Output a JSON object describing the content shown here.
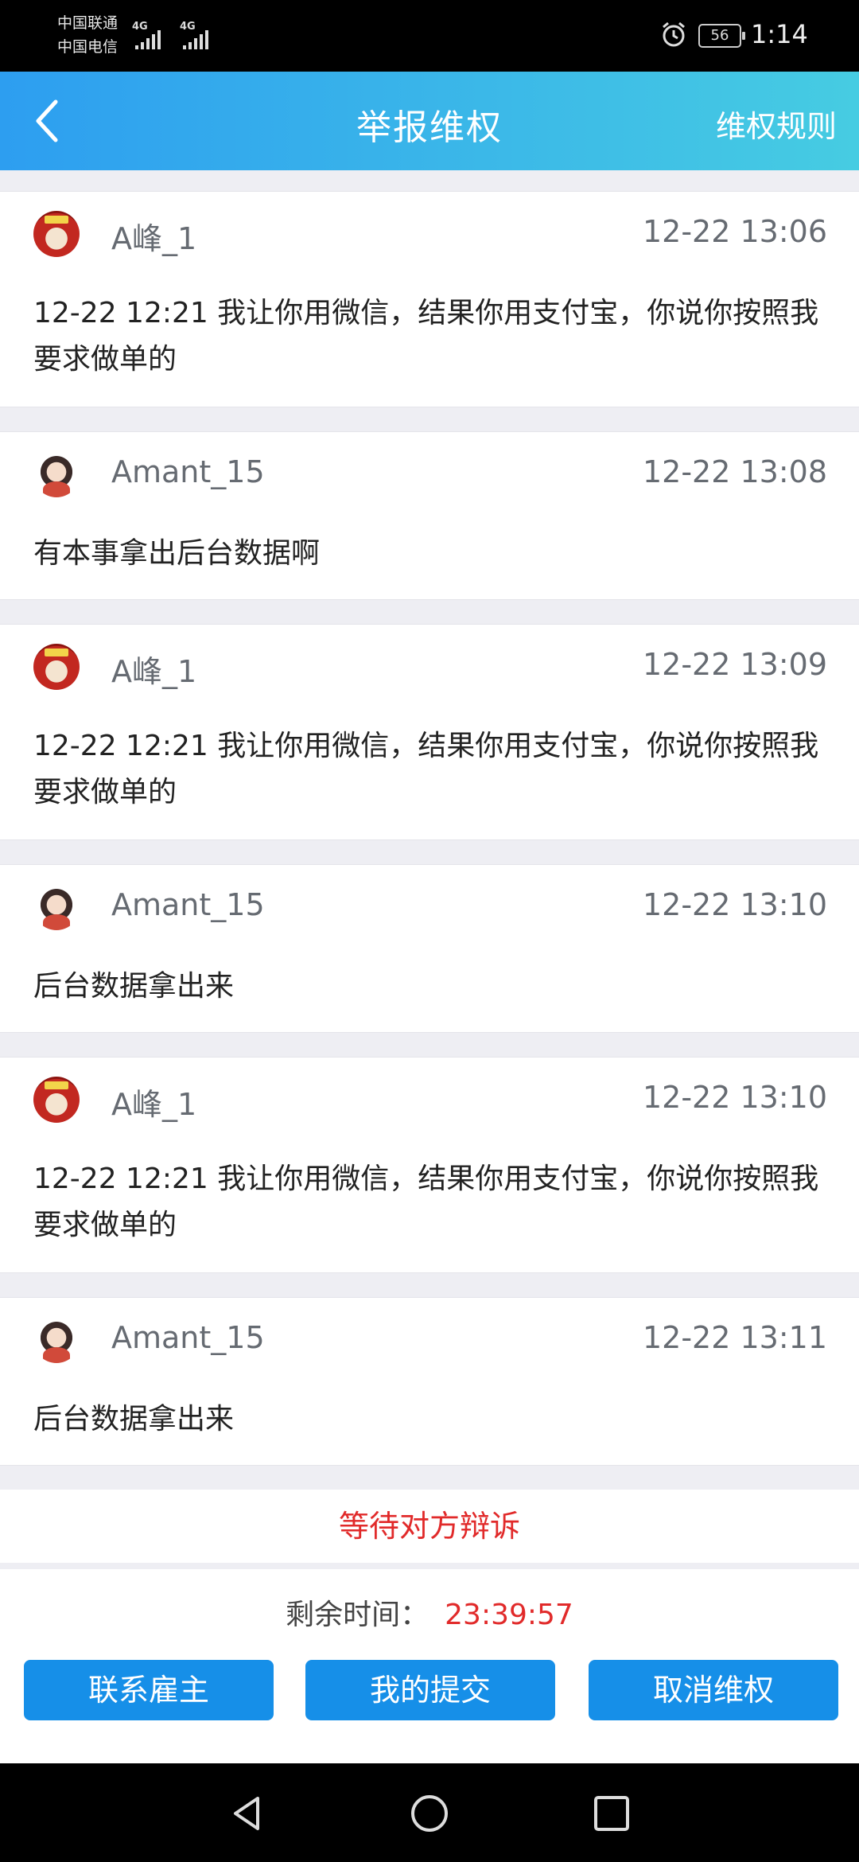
{
  "status_bar": {
    "carrier_1": "中国联通",
    "carrier_2": "中国电信",
    "network_1": "4G",
    "network_2": "4G",
    "battery": "56",
    "time": "1:14"
  },
  "header": {
    "title": "举报维权",
    "rules_link": "维权规则"
  },
  "messages": [
    {
      "user": "A峰_1",
      "time": "12-22 13:06",
      "text": "12-22 12:21 我让你用微信，结果你用支付宝，你说你按照我要求做单的",
      "avatar": "avatar-a"
    },
    {
      "user": "Amant_15",
      "time": "12-22 13:08",
      "text": "有本事拿出后台数据啊",
      "avatar": "avatar-b"
    },
    {
      "user": "A峰_1",
      "time": "12-22 13:09",
      "text": "12-22 12:21 我让你用微信，结果你用支付宝，你说你按照我要求做单的",
      "avatar": "avatar-a"
    },
    {
      "user": "Amant_15",
      "time": "12-22 13:10",
      "text": "后台数据拿出来",
      "avatar": "avatar-b"
    },
    {
      "user": "A峰_1",
      "time": "12-22 13:10",
      "text": "12-22 12:21 我让你用微信，结果你用支付宝，你说你按照我要求做单的",
      "avatar": "avatar-a"
    },
    {
      "user": "Amant_15",
      "time": "12-22 13:11",
      "text": "后台数据拿出来",
      "avatar": "avatar-b"
    }
  ],
  "case_status": "等待对方辩诉",
  "footer": {
    "remaining_label": "剩余时间：",
    "remaining_value": "23:39:57",
    "buttons": [
      "联系雇主",
      "我的提交",
      "取消维权"
    ]
  },
  "colors": {
    "header_start": "#2d9ef0",
    "header_end": "#46cce2",
    "accent_red": "#e12a2a",
    "button_blue": "#168fe8"
  }
}
